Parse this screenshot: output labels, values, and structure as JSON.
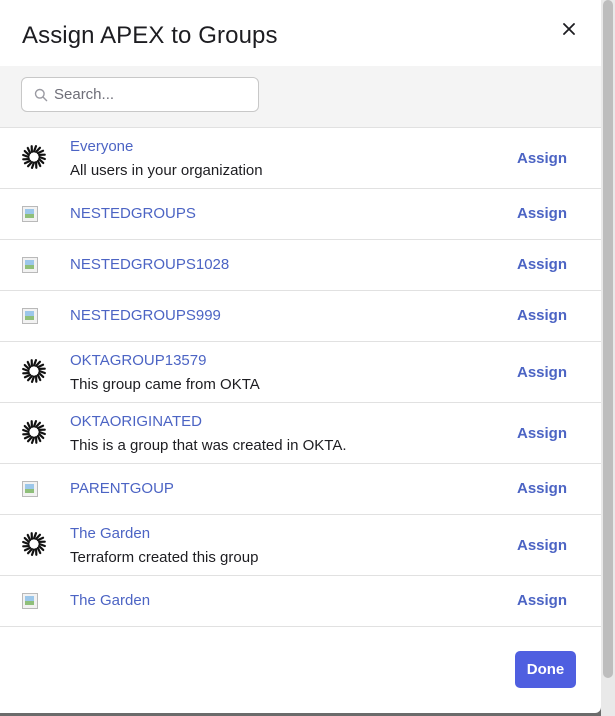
{
  "dialog": {
    "title": "Assign APEX to Groups",
    "close_icon": "close-icon"
  },
  "search": {
    "placeholder": "Search...",
    "value": "",
    "icon": "search-icon"
  },
  "groups": [
    {
      "name": "Everyone",
      "description": "All users in your organization",
      "icon": "okta-sunburst-icon",
      "action": "Assign"
    },
    {
      "name": "NESTEDGROUPS",
      "description": "",
      "icon": "broken-image-icon",
      "action": "Assign"
    },
    {
      "name": "NESTEDGROUPS1028",
      "description": "",
      "icon": "broken-image-icon",
      "action": "Assign"
    },
    {
      "name": "NESTEDGROUPS999",
      "description": "",
      "icon": "broken-image-icon",
      "action": "Assign"
    },
    {
      "name": "OKTAGROUP13579",
      "description": "This group came from OKTA",
      "icon": "okta-sunburst-icon",
      "action": "Assign"
    },
    {
      "name": "OKTAORIGINATED",
      "description": "This is a group that was created in OKTA.",
      "icon": "okta-sunburst-icon",
      "action": "Assign"
    },
    {
      "name": "PARENTGOUP",
      "description": "",
      "icon": "broken-image-icon",
      "action": "Assign"
    },
    {
      "name": "The Garden",
      "description": "Terraform created this group",
      "icon": "okta-sunburst-icon",
      "action": "Assign"
    },
    {
      "name": "The Garden",
      "description": "",
      "icon": "broken-image-icon",
      "action": "Assign"
    }
  ],
  "footer": {
    "done_label": "Done"
  },
  "colors": {
    "link": "#4c64c4",
    "primary_button": "#4f5fe0",
    "text": "#1d1d21",
    "search_band": "#f4f4f4"
  }
}
